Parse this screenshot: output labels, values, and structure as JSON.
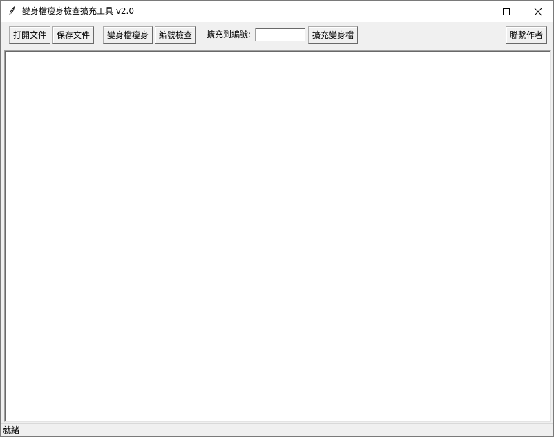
{
  "window": {
    "title": "變身檔瘦身檢查擴充工具 v2.0"
  },
  "toolbar": {
    "open_label": "打開文件",
    "save_label": "保存文件",
    "slim_label": "變身檔瘦身",
    "check_label": "編號檢查",
    "expand_to_label": "擴充到編號:",
    "expand_to_value": "",
    "expand_label": "擴充變身檔",
    "contact_label": "聯繫作者"
  },
  "editor": {
    "content": ""
  },
  "status": {
    "text": "就緒"
  },
  "icons": {
    "app": "feather-icon",
    "minimize": "minimize-icon",
    "maximize": "maximize-icon",
    "close": "close-icon"
  }
}
